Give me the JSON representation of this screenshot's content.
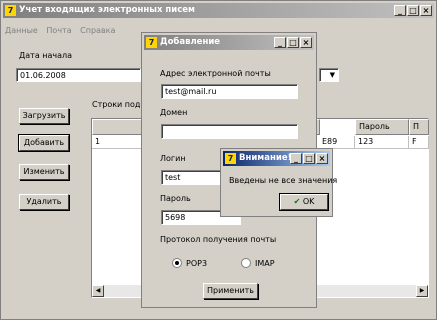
{
  "main_window": {
    "title": "Учет входящих электронных писем",
    "menu": [
      "Данные",
      "Почта",
      "Справка"
    ],
    "date_label": "Дата начала",
    "date_value": "01.06.2008",
    "rows_label": "Строки подкл",
    "buttons": {
      "load": "Загрузить",
      "add": "Добавить",
      "edit": "Изменить",
      "delete": "Удалить"
    },
    "table": {
      "headers": [
        "",
        "Пароль",
        "П"
      ],
      "rows": [
        {
          "num": "1",
          "mid": "E89",
          "password": "123",
          "extra": "F"
        }
      ]
    }
  },
  "add_dialog": {
    "title": "Добавление",
    "email_label": "Адрес электронной почты",
    "email_value": "test@mail.ru",
    "domain_label": "Домен",
    "domain_value": "",
    "login_label": "Логин",
    "login_value": "test",
    "password_label": "Пароль",
    "password_value": "5698",
    "protocol_label": "Протокол получения почты",
    "protocols": [
      "POP3",
      "IMAP"
    ],
    "selected_protocol": "POP3",
    "apply_button": "Применить"
  },
  "alert_dialog": {
    "title": "Внимание!",
    "message": "Введены не все значения",
    "ok_button": "OK"
  }
}
